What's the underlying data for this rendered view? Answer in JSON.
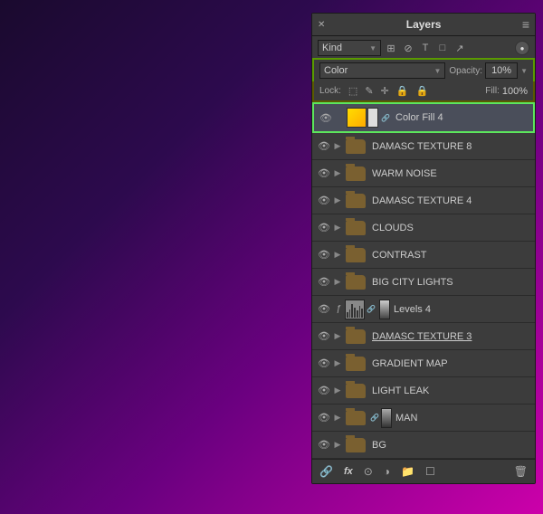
{
  "panel": {
    "title": "Layers",
    "menu_icon": "≡",
    "close_x": "✕"
  },
  "controls": {
    "kind_label": "Kind",
    "blend_mode_label": "Color",
    "opacity_label": "Opacity:",
    "opacity_value": "10%",
    "lock_label": "Lock:",
    "fill_label": "Fill:",
    "fill_value": "100%"
  },
  "filter_icons": [
    "🔍",
    "⊘",
    "T",
    "⊞",
    "↗"
  ],
  "layers": [
    {
      "id": "color-fill-4",
      "name": "Color Fill 4",
      "type": "color-fill",
      "visible": true,
      "active": true,
      "has_chain": true
    },
    {
      "id": "damasc-texture-8",
      "name": "DAMASC TEXTURE 8",
      "type": "folder",
      "visible": true,
      "active": false
    },
    {
      "id": "warm-noise",
      "name": "WARM NOISE",
      "type": "folder",
      "visible": true,
      "active": false
    },
    {
      "id": "damasc-texture-4",
      "name": "DAMASC TEXTURE 4",
      "type": "folder",
      "visible": true,
      "active": false
    },
    {
      "id": "clouds",
      "name": "CLOUDS",
      "type": "folder",
      "visible": true,
      "active": false
    },
    {
      "id": "contrast",
      "name": "CONTRAST",
      "type": "folder",
      "visible": true,
      "active": false
    },
    {
      "id": "big-city-lights",
      "name": "BIG CITY LIGHTS",
      "type": "folder",
      "visible": true,
      "active": false
    },
    {
      "id": "levels-4",
      "name": "Levels 4",
      "type": "levels",
      "visible": true,
      "active": false,
      "has_chain": true
    },
    {
      "id": "damasc-texture-3",
      "name": "DAMASC TEXTURE 3",
      "type": "folder",
      "visible": true,
      "active": false,
      "underline": true
    },
    {
      "id": "gradient-map",
      "name": "GRADIENT MAP",
      "type": "folder",
      "visible": true,
      "active": false
    },
    {
      "id": "light-leak",
      "name": "LIGHT LEAK",
      "type": "folder",
      "visible": true,
      "active": false
    },
    {
      "id": "man",
      "name": "MAN",
      "type": "folder-chain",
      "visible": true,
      "active": false,
      "has_chain": true
    },
    {
      "id": "bg",
      "name": "BG",
      "type": "folder",
      "visible": true,
      "active": false
    }
  ],
  "toolbar": {
    "link_label": "🔗",
    "fx_label": "fx",
    "new_layer_label": "☐",
    "delete_label": "🗑",
    "mask_label": "⊙",
    "group_label": "📁",
    "adjust_label": "◑"
  }
}
